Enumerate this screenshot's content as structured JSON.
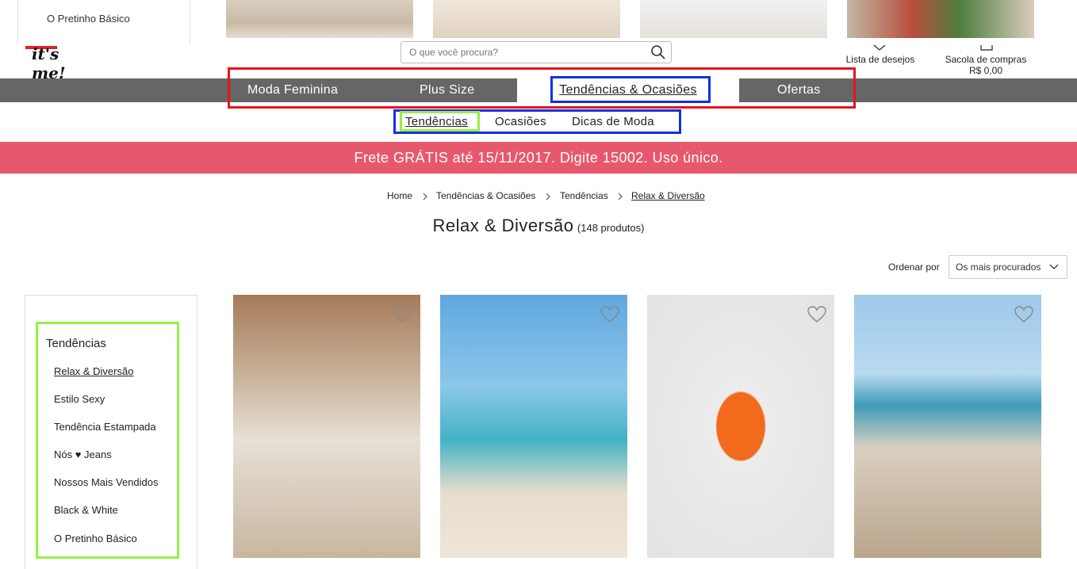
{
  "top_dropdown": {
    "item": "O Pretinho Básico"
  },
  "logo": {
    "text": "it's me!"
  },
  "search": {
    "placeholder": "O que você procura?"
  },
  "utility": {
    "wishlist_label": "Lista de desejos",
    "bag_label": "Sacola de compras",
    "bag_total": "R$ 0,00"
  },
  "main_nav": {
    "items": [
      "Moda Feminina",
      "Plus Size",
      "Tendências & Ocasiões",
      "Ofertas"
    ]
  },
  "sub_nav": {
    "items": [
      "Tendências",
      "Ocasiões",
      "Dicas de Moda"
    ]
  },
  "promo": {
    "text": "Frete GRÁTIS até 15/11/2017. Digite 15002. Uso único."
  },
  "breadcrumb": {
    "items": [
      "Home",
      "Tendências & Ocasiões",
      "Tendências",
      "Relax & Diversão"
    ]
  },
  "page": {
    "title": "Relax & Diversão",
    "count": "(148 produtos)"
  },
  "sort": {
    "label": "Ordenar por",
    "value": "Os mais procurados"
  },
  "sidebar": {
    "heading": "Tendências",
    "items": [
      "Relax & Diversão",
      "Estilo Sexy",
      "Tendência Estampada",
      "Nós ♥ Jeans",
      "Nossos Mais Vendidos",
      "Black & White",
      "O Pretinho Básico"
    ]
  },
  "colors": {
    "nav_bg": "#666666",
    "promo_bg": "#e8586c",
    "highlight_red": "#e8141c",
    "highlight_blue": "#1430e0",
    "highlight_green": "#99ee44"
  }
}
